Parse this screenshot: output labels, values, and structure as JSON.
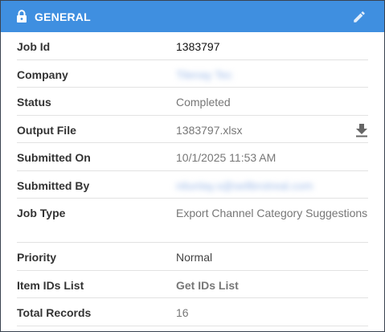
{
  "header": {
    "title": "GENERAL",
    "lock_icon": "lock-icon",
    "edit_icon": "pencil-icon",
    "background": "#3f8fe0"
  },
  "fields": [
    {
      "label": "Job Id",
      "value": "1383797"
    },
    {
      "label": "Company",
      "value": "Tilenay Tec"
    },
    {
      "label": "Status",
      "value": "Completed"
    },
    {
      "label": "Output File",
      "value": "1383797.xlsx",
      "action_icon": "download-icon"
    },
    {
      "label": "Submitted On",
      "value": "10/1/2025 11:53 AM"
    },
    {
      "label": "Submitted By",
      "value": "nilunlay.s@sellbrotreal.com"
    },
    {
      "label": "Job Type",
      "value": "Export Channel Category Suggestions"
    },
    {
      "label": "Priority",
      "value": "Normal"
    },
    {
      "label": "Item IDs List",
      "value": "Get IDs List"
    },
    {
      "label": "Total Records",
      "value": "16"
    }
  ],
  "colors": {
    "link": "#2f7fd9",
    "label": "#333333",
    "value": "#777777"
  }
}
